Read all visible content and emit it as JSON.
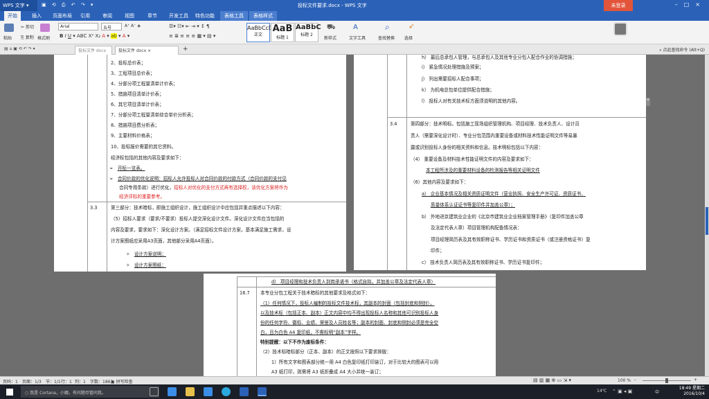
{
  "app": {
    "name": "WPS 文字",
    "title": "投标文件要求.docx - WPS 文字",
    "login": "未登录"
  },
  "tabs": [
    "开始",
    "插入",
    "页面布局",
    "引用",
    "审阅",
    "视图",
    "章节",
    "开发工具",
    "特色功能",
    "表格工具",
    "表格样式"
  ],
  "ribbon": {
    "paste": "粘贴",
    "cut": "剪切",
    "copy": "复制",
    "format_painter": "格式刷",
    "font": "Arial",
    "size": "五号",
    "styles": [
      {
        "preview": "AaBbCcD",
        "label": "正文"
      },
      {
        "preview": "AaB",
        "label": "标题 1"
      },
      {
        "preview": "AaBbC",
        "label": "标题 2"
      }
    ],
    "new_style": "新样式",
    "text_tools": "文字工具",
    "find_replace": "查找替换",
    "select": "选择"
  },
  "doc_tabs": [
    {
      "label": "投标文件 docx"
    },
    {
      "label": "投标文件 docx"
    }
  ],
  "search_cmd": "点此查找命令 (Alt+Q)",
  "page1": {
    "lines": [
      "2、投标总价表；",
      "3、工程项目总价表；",
      "4、分部分项工程量清单计价表；",
      "5、措施项目清单计价表；",
      "6、其它项目清单计价表；",
      "7、分部分项工程量清单综合单价分析表；",
      "8、措施项目费分析表；",
      "9、主要材料价格表；",
      "10、投标报价需要的其它资料。",
      "经济标包括的其他内容及要求如下："
    ],
    "bullet1": "开标一览表。",
    "bullet2a": "合同价款的优化说明：",
    "bullet2b": "招标人允许投标人对合同价款的付款方式（合同价款的支付见",
    "bullet2c": "合同专用条款）进行优化，",
    "bullet2d": "招标人对优化的支付方式再有选择权，该优化方案将作为",
    "bullet2e": "经济评标的重要参考。",
    "sec_no": "3.3",
    "sec_lines": [
      "第三部分：技术暗标，即施工组织设计，施工组织设计中应包括并重点描述以下内容：",
      "（5）招标人要求（要求/不要求）投标人提交深化设计文件。深化设计文件应当包括的",
      "内容及要求，要求如下：深化设计方案。（满足招标文件设计方案，基本满足施工需求，设",
      "计方案图纸应采用A3页面，其他部分采用A4页面）。"
    ],
    "sub1": "设计方案说明；",
    "sub2": "设计方案图纸；"
  },
  "page2": {
    "top_items": [
      "h）  最后总承包人管理，与总承包人及其他专业分包人配合作业的协调措施；",
      "i）  紧急情况处理措施及预案；",
      "j）  列出需要招标人配合事项；",
      "k）  为机电总包单位提供配合措施；",
      "l）  投标人对有关技术标方面须说明的其他内容。"
    ],
    "sec_no": "3.4",
    "sec_lines": [
      "第四部分：技术明标。包括施工现场组织管理机构、项目经理、技术负责人、设计员",
      "责人（需要深化设计时）、专业分包范围内重要设备或材料技术性能证明文件等易暴",
      "露或识别投标人身份的相关资料和信息。技术明标包括以下内容："
    ],
    "item4": "（4）  重要设备及材料技术性能证明文件的内容及要求如下：",
    "item4a": "本工程所涉及的重要材料设备的检测报告等相关证明文件",
    "item6": "（6）其他内容及要求如下：",
    "a1": "a）  企业基本情况及相关资质证明文件（营业执照、安全生产许可证、资质证书、",
    "a2": "质量体系认证证书等复印件并加盖公章）；",
    "b1": "b）  外地进京建筑业企业的《北京市建筑业企业档案管理手册》（复印件加盖公章",
    "b2": "及法定代表人章）项目管理机构配备情况表：",
    "b3": "项目经理简历表及其有效职称证书、学历证书和资质证书（或注册资格证书）复",
    "b4": "印件；",
    "c1": "c）  技术负责人简历表及其有效职称证书、学历证书复印件；"
  },
  "page3": {
    "d": "d）  项目经理和技术负责人到岗承诺书（格式自拟，并加盖公章及法定代表人章）",
    "sec_no": "16.7",
    "lines": [
      "本专业分包工程关于技术暗标的其他要求及格式如下：",
      "（1）任何情况下，投标人编制的投标文件技术标，其副本的封面（包括封底和侧封），",
      "以及技术标（包括正本、副本）正文内容中均不得出现投标人名称和其他可识别投标人身",
      "份的任何字符、徽标、业绩、荣誉及人员姓名等；副本的封面、封底和侧封必须是完全空",
      "白，且为白色 A4 复印纸，不需标明“副本”字样。"
    ],
    "special": "特别提醒：以下不作为废标条件：",
    "lines2": [
      "（2）技术标暗标部分（正本、副本）的正文按照以下要求排版：",
      "1）所有文字和图表部分统一用 A4 白色复印纸打印装订，对于比较大的图表可以用",
      "A3 纸打印，则需将 A3 纸折叠成 A4 大小并统一装订；"
    ]
  },
  "status": {
    "page": "页码：1",
    "pages": "页面：1/3",
    "section": "节：1/1",
    "row": "行：1",
    "col": "列：1",
    "words": "字数：1863",
    "spell": "拼写检查",
    "zoom": "100 %"
  },
  "taskbar": {
    "search": "我是 Cortana，小娜。有问题尽管问我。",
    "temp": "14℃",
    "lang": "中",
    "time": "18:49",
    "weekday": "星期二",
    "date": "2016/10/4"
  },
  "colors": {
    "brand": "#2b62b8",
    "red": "#d22",
    "login": "#e3553b"
  }
}
